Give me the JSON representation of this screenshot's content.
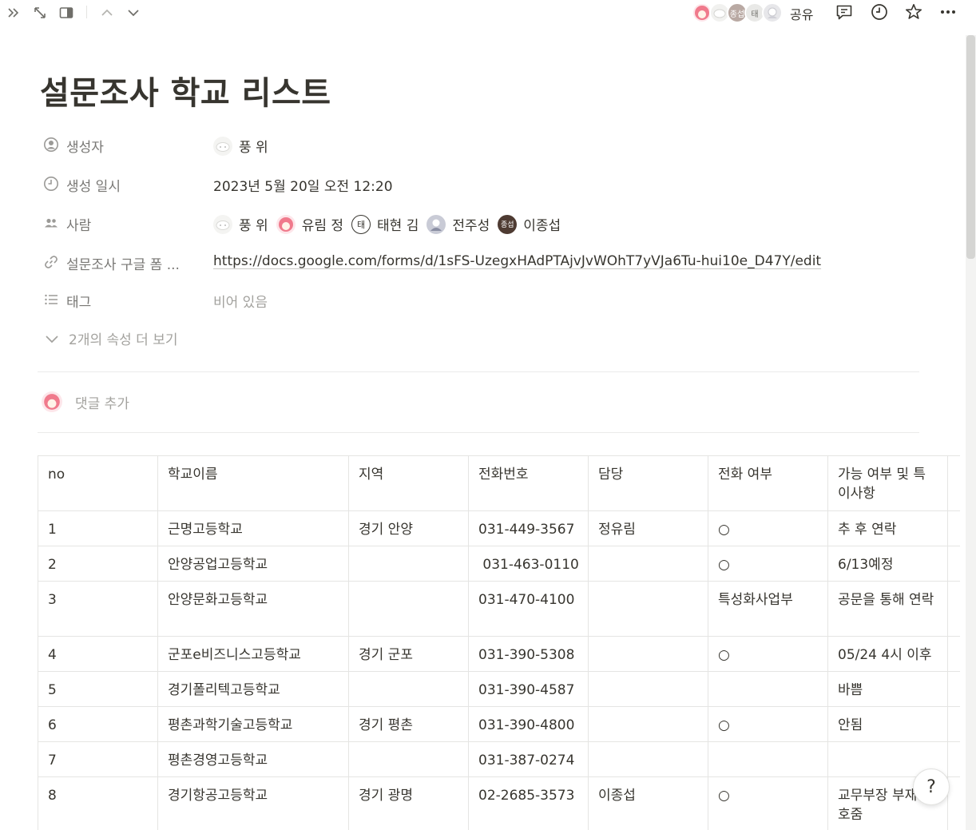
{
  "page": {
    "title": "설문조사 학교 리스트"
  },
  "topbar": {
    "share_label": "공유",
    "avatar_labels": [
      "종섭",
      "태"
    ],
    "icons": [
      "double-chevron-right-icon",
      "expand-icon",
      "side-peek-icon",
      "chevron-up-icon",
      "chevron-down-icon",
      "comment-icon",
      "clock-icon",
      "star-icon",
      "more-icon"
    ]
  },
  "properties": [
    {
      "icon": "person-circle-icon",
      "label": "생성자",
      "type": "person"
    },
    {
      "icon": "clock-icon",
      "label": "생성 일시",
      "value": "2023년 5월 20일 오전 12:20"
    },
    {
      "icon": "people-icon",
      "label": "사람",
      "type": "people"
    },
    {
      "icon": "link-icon",
      "label": "설문조사 구글 폼 ...",
      "value": "https://docs.google.com/forms/d/1sFS-UzegxHAdPTAjvJvWOhT7yVJa6Tu-hui10e_D47Y/edit"
    },
    {
      "icon": "list-icon",
      "label": "태그",
      "value": "비어 있음"
    }
  ],
  "creator": {
    "name": "풍 위"
  },
  "people": [
    {
      "name": "풍 위",
      "avatar_text": ""
    },
    {
      "name": "유림 정",
      "avatar_text": ""
    },
    {
      "name": "태현 김",
      "avatar_text": "태"
    },
    {
      "name": "전주성",
      "avatar_text": ""
    },
    {
      "name": "이종섭",
      "avatar_text": "종섭"
    }
  ],
  "more_properties_label": "2개의 속성 더 보기",
  "comment": {
    "placeholder": "댓글 추가"
  },
  "table": {
    "headers": [
      "no",
      "학교이름",
      "지역",
      "전화번호",
      "담당",
      "전화 여부",
      "가능 여부 및 특이사항"
    ],
    "rows": [
      [
        "1",
        "근명고등학교",
        "경기 안양",
        "031-449-3567",
        "정유림",
        "○",
        "추 후 연락"
      ],
      [
        "2",
        "안양공업고등학교",
        "",
        " 031-463-0110",
        "",
        "○",
        "6/13예정"
      ],
      [
        "3",
        "안양문화고등학교",
        "",
        "031-470-4100",
        "",
        "특성화사업부",
        "공문을 통해 연락"
      ],
      [
        "4",
        "군포e비즈니스고등학교",
        "경기 군포",
        "031-390-5308",
        "",
        "○",
        "05/24 4시 이후"
      ],
      [
        "5",
        "경기폴리텍고등학교",
        "",
        "031-390-4587",
        "",
        "",
        "바쁨"
      ],
      [
        "6",
        "평촌과학기술고등학교",
        "경기 평촌",
        "031-390-4800",
        "",
        "○",
        "안됨"
      ],
      [
        "7",
        "평촌경영고등학교",
        "",
        "031-387-0274",
        "",
        "",
        ""
      ],
      [
        "8",
        "경기항공고등학교",
        "경기 광명",
        "02-2685-3573",
        "이종섭",
        "○",
        "교무부장 부재 번호줌"
      ]
    ]
  },
  "help_label": "?"
}
